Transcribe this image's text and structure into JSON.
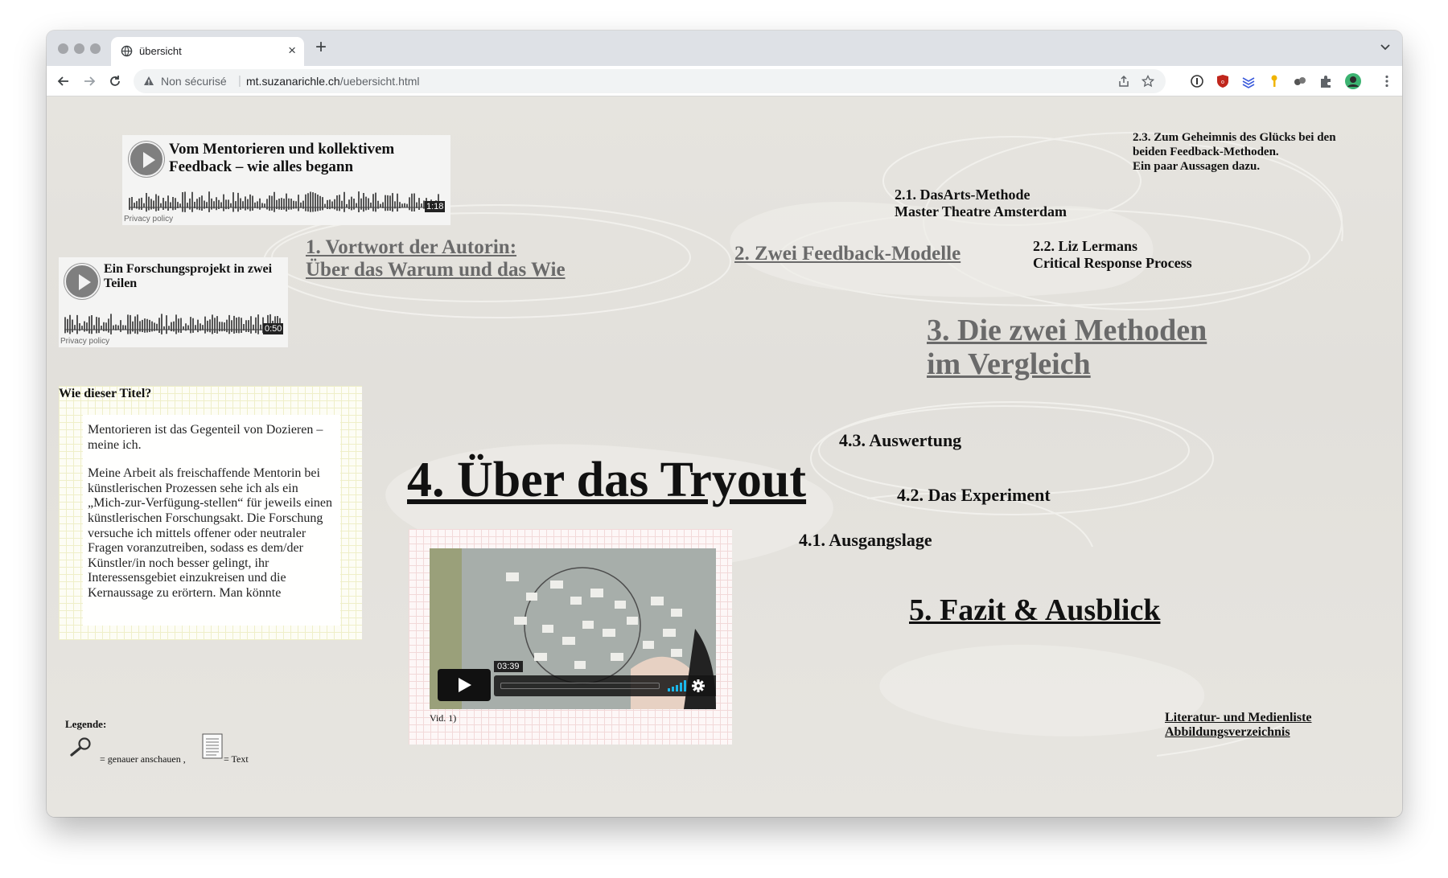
{
  "browser": {
    "tab_title": "übersicht",
    "security_label": "Non sécurisé",
    "url_host": "mt.suzanarichle.ch",
    "url_path": "/uebersicht.html"
  },
  "audio_players": [
    {
      "title": "Vom Mentorieren und kollektivem Feedback – wie alles begann",
      "duration": "1:18",
      "privacy": "Privacy policy"
    },
    {
      "title": "Ein Forschungsprojekt in zwei Teilen",
      "duration": "0:50",
      "privacy": "Privacy policy"
    }
  ],
  "nav_links": {
    "ch1_line1": "1. Vortwort der Autorin:",
    "ch1_line2": "Über das Warum und das Wie",
    "ch2": "2. Zwei Feedback-Modelle",
    "ch2_1_line1": "2.1. DasArts-Methode",
    "ch2_1_line2": "Master Theatre Amsterdam",
    "ch2_2_line1": "2.2. Liz Lermans",
    "ch2_2_line2": "Critical Response Process",
    "ch2_3_line1": "2.3. Zum Geheimnis des Glücks bei den",
    "ch2_3_line2": "beiden Feedback-Methoden.",
    "ch2_3_line3": "Ein paar Aussagen dazu.",
    "ch3_line1": "3. Die zwei Methoden",
    "ch3_line2": "im Vergleich",
    "ch4": "4. Über das Tryout",
    "ch4_3": "4.3. Auswertung",
    "ch4_2": "4.2. Das Experiment",
    "ch4_1": "4.1. Ausgangslage",
    "ch5": "5. Fazit & Ausblick",
    "literatur": "Literatur- und Medienliste",
    "abbildungen": "Abbildungsverzeichnis"
  },
  "title_box": {
    "heading": "Wie dieser Titel?",
    "para1": "Mentorieren ist das Gegenteil von Dozieren – meine ich.",
    "para2": "Meine Arbeit als freischaffende Mentorin bei künstlerischen Prozessen sehe ich als ein „Mich-zur-Verfügung-stellen“ für jeweils einen künstlerischen Forschungsakt. Die Forschung versuche ich mittels offener oder neutraler Fragen voranzutreiben, sodass es dem/der Künstler/in noch besser gelingt, ihr Interessensgebiet einzukreisen und die Kernaussage zu erörtern. Man könnte"
  },
  "video": {
    "duration": "03:39",
    "caption": "Vid. 1)"
  },
  "legend": {
    "title": "Legende:",
    "look_closer": "= genauer anschauen ,",
    "text": "= Text"
  },
  "icons": [
    "globe-icon",
    "close-icon",
    "plus-icon",
    "back-icon",
    "forward-icon",
    "reload-icon",
    "warning-icon",
    "share-icon",
    "star-icon",
    "play-icon",
    "gear-icon",
    "magnifier-icon",
    "document-icon"
  ]
}
